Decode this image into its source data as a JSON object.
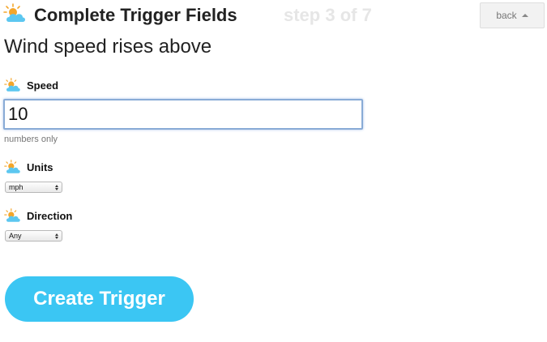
{
  "header": {
    "title": "Complete Trigger Fields",
    "step": "step 3 of 7",
    "back_label": "back"
  },
  "trigger": {
    "subtitle": "Wind speed rises above"
  },
  "fields": {
    "speed": {
      "label": "Speed",
      "value": "10",
      "hint": "numbers only"
    },
    "units": {
      "label": "Units",
      "selected": "mph"
    },
    "direction": {
      "label": "Direction",
      "selected": "Any"
    }
  },
  "actions": {
    "create_label": "Create Trigger"
  },
  "colors": {
    "accent": "#3bc6f3",
    "cloud": "#5cc7f0",
    "sun": "#f4a62a",
    "step_text": "#e6e6e6"
  },
  "icons": {
    "channel": "weather-sun-cloud-icon",
    "back": "caret-up-icon"
  }
}
